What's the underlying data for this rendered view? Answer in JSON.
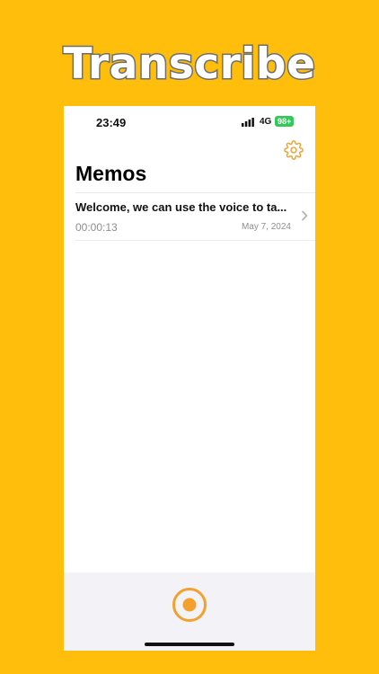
{
  "banner": {
    "title": "Transcribe"
  },
  "status_bar": {
    "time": "23:49",
    "network": "4G",
    "battery": "98+"
  },
  "header": {
    "title": "Memos",
    "settings_icon": "gear-icon"
  },
  "memos": [
    {
      "title": "Welcome, we can use the voice to ta...",
      "duration": "00:00:13",
      "date": "May 7, 2024"
    }
  ],
  "bottom_bar": {
    "record_icon": "record-icon"
  },
  "colors": {
    "background": "#FFBE0B",
    "accent": "#F2A02E",
    "battery": "#34C759",
    "secondary_text": "#8E8E93"
  }
}
